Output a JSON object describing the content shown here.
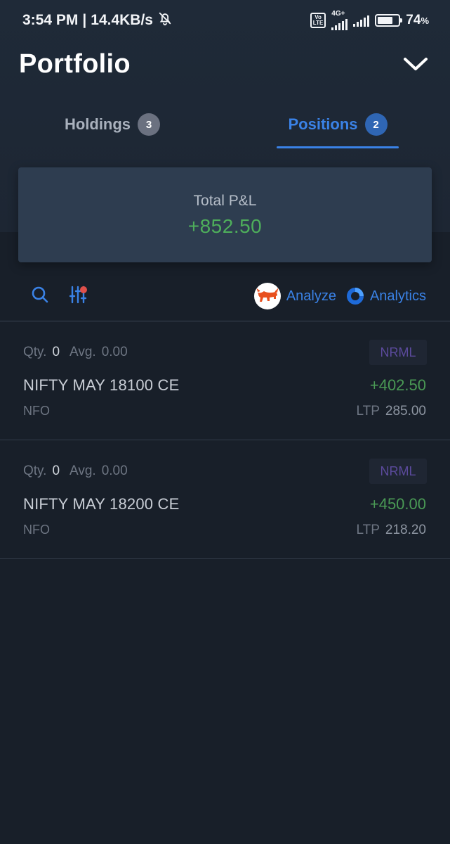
{
  "status_bar": {
    "time": "3:54 PM",
    "separator": "|",
    "speed": "14.4KB/s",
    "network": "4G+",
    "volte_line1": "Vo",
    "volte_line2": "LTE",
    "battery_percent": "74",
    "battery_level": 0.74,
    "battery_unit": "%"
  },
  "header": {
    "title": "Portfolio",
    "toggle_icon": "chevron-down-icon"
  },
  "tabs": [
    {
      "label": "Holdings",
      "count": "3",
      "active": false
    },
    {
      "label": "Positions",
      "count": "2",
      "active": true
    }
  ],
  "summary": {
    "label": "Total P&L",
    "value": "+852.50",
    "value_color": "#4eae5b"
  },
  "toolbar": {
    "search_icon": "search-icon",
    "filter_icon": "filter-sliders-icon",
    "analyze_label": "Analyze",
    "analytics_label": "Analytics"
  },
  "positions": [
    {
      "qty_label": "Qty.",
      "qty": "0",
      "avg_label": "Avg.",
      "avg": "0.00",
      "product": "NRML",
      "symbol": "NIFTY MAY 18100 CE",
      "pnl": "+402.50",
      "exchange": "NFO",
      "ltp_label": "LTP",
      "ltp": "285.00"
    },
    {
      "qty_label": "Qty.",
      "qty": "0",
      "avg_label": "Avg.",
      "avg": "0.00",
      "product": "NRML",
      "symbol": "NIFTY MAY 18200 CE",
      "pnl": "+450.00",
      "exchange": "NFO",
      "ltp_label": "LTP",
      "ltp": "218.20"
    }
  ],
  "colors": {
    "accent": "#3a82e6",
    "profit": "#4eae5b",
    "background": "#181f29",
    "card": "#2e3d50"
  }
}
